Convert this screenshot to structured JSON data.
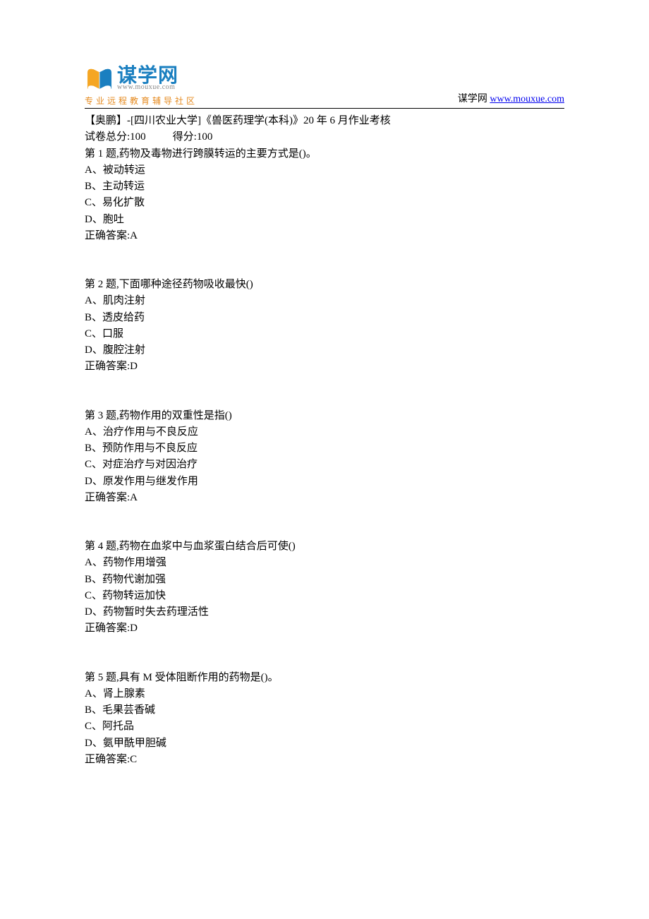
{
  "header": {
    "logo_cn": "谋学网",
    "logo_url": "www.mouxue.com",
    "logo_tagline": "专业远程教育辅导社区",
    "site_label": "谋学网",
    "site_link": "www.mouxue.com"
  },
  "exam": {
    "title": "【奥鹏】-[四川农业大学]《兽医药理学(本科)》20 年 6 月作业考核",
    "total_label": "试卷总分:",
    "total_value": "100",
    "score_label": "得分:",
    "score_value": "100"
  },
  "questions": [
    {
      "stem": "第 1 题,药物及毒物进行跨膜转运的主要方式是()。",
      "options": [
        "A、被动转运",
        "B、主动转运",
        "C、易化扩散",
        "D、胞吐"
      ],
      "answer": "正确答案:A"
    },
    {
      "stem": "第 2 题,下面哪种途径药物吸收最快()",
      "options": [
        "A、肌肉注射",
        "B、透皮给药",
        "C、口服",
        "D、腹腔注射"
      ],
      "answer": "正确答案:D"
    },
    {
      "stem": "第 3 题,药物作用的双重性是指()",
      "options": [
        "A、治疗作用与不良反应",
        "B、预防作用与不良反应",
        "C、对症治疗与对因治疗",
        "D、原发作用与继发作用"
      ],
      "answer": "正确答案:A"
    },
    {
      "stem": "第 4 题,药物在血浆中与血浆蛋白结合后可使()",
      "options": [
        "A、药物作用增强",
        "B、药物代谢加强",
        "C、药物转运加快",
        "D、药物暂时失去药理活性"
      ],
      "answer": "正确答案:D"
    },
    {
      "stem": "第 5 题,具有 M 受体阻断作用的药物是()。",
      "options": [
        "A、肾上腺素",
        "B、毛果芸香碱",
        "C、阿托品",
        "D、氨甲酰甲胆碱"
      ],
      "answer": "正确答案:C"
    }
  ]
}
